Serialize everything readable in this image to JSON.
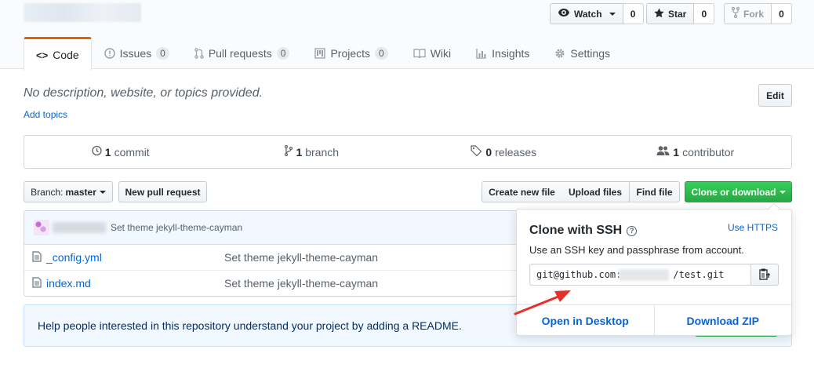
{
  "repo": {
    "name_redacted": true
  },
  "social": {
    "watch": {
      "label": "Watch",
      "count": "0"
    },
    "star": {
      "label": "Star",
      "count": "0"
    },
    "fork": {
      "label": "Fork",
      "count": "0"
    }
  },
  "tabs": [
    {
      "label": "Code",
      "icon": "code-icon",
      "counter": null
    },
    {
      "label": "Issues",
      "icon": "issue-icon",
      "counter": "0"
    },
    {
      "label": "Pull requests",
      "icon": "pull-request-icon",
      "counter": "0"
    },
    {
      "label": "Projects",
      "icon": "project-icon",
      "counter": "0"
    },
    {
      "label": "Wiki",
      "icon": "book-icon",
      "counter": null
    },
    {
      "label": "Insights",
      "icon": "graph-icon",
      "counter": null
    },
    {
      "label": "Settings",
      "icon": "gear-icon",
      "counter": null
    }
  ],
  "description": {
    "text": "No description, website, or topics provided.",
    "add_topics": "Add topics",
    "edit_label": "Edit"
  },
  "summary": [
    {
      "icon": "history-icon",
      "count": "1",
      "label": "commit"
    },
    {
      "icon": "branch-icon",
      "count": "1",
      "label": "branch"
    },
    {
      "icon": "tag-icon",
      "count": "0",
      "label": "releases"
    },
    {
      "icon": "people-icon",
      "count": "1",
      "label": "contributor"
    }
  ],
  "file_nav": {
    "branch_prefix": "Branch:",
    "branch_name": "master",
    "new_pr": "New pull request",
    "create_file": "Create new file",
    "upload_files": "Upload files",
    "find_file": "Find file",
    "clone": "Clone or download"
  },
  "commit": {
    "message": "Set theme jekyll-theme-cayman"
  },
  "files": [
    {
      "name": "_config.yml",
      "message": "Set theme jekyll-theme-cayman"
    },
    {
      "name": "index.md",
      "message": "Set theme jekyll-theme-cayman"
    }
  ],
  "readme_notice": "Help people interested in this repository understand your project by adding a README.",
  "clone_popover": {
    "title": "Clone with SSH",
    "use_https": "Use HTTPS",
    "description": "Use an SSH key and passphrase from account.",
    "url_prefix": "git@github.com:",
    "url_suffix": "/test.git",
    "open_desktop": "Open in Desktop",
    "download_zip": "Download ZIP"
  },
  "colors": {
    "accent_green": "#28a745",
    "link_blue": "#0366d6",
    "annotation_red": "#e5312b",
    "tab_orange": "#e36209"
  }
}
